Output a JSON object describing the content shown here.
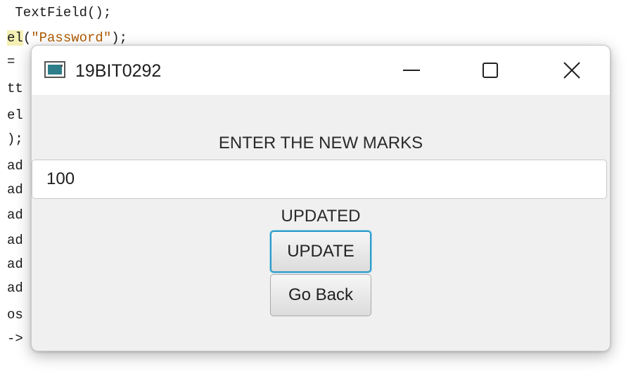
{
  "editor": {
    "lines": [
      {
        "plain": " TextField();"
      },
      {
        "hl": "el",
        "open": "(",
        "str": "\"Password\"",
        "close": ");"
      },
      {
        "plain": "="
      },
      {
        "plain": "tt"
      },
      {
        "plain": "el"
      },
      {
        "plain": ");"
      },
      {
        "plain": "ad"
      },
      {
        "plain": "ad"
      },
      {
        "plain": "ad"
      },
      {
        "plain": "ad"
      },
      {
        "plain": "ad"
      },
      {
        "plain": "ad"
      },
      {
        "plain": "os"
      },
      {
        "plain": "->"
      }
    ]
  },
  "dialog": {
    "title": "19BIT0292",
    "prompt": "ENTER THE NEW MARKS",
    "input_value": "100",
    "status": "UPDATED",
    "update_button": "UPDATE",
    "back_button": "Go Back"
  },
  "window_controls": {
    "icons": [
      "app-window-icon",
      "minimize-icon",
      "maximize-icon",
      "close-icon"
    ]
  },
  "colors": {
    "focus_ring": "#2b9bc9",
    "string_literal": "#b05a00",
    "line_highlight": "#f4f0b4"
  }
}
